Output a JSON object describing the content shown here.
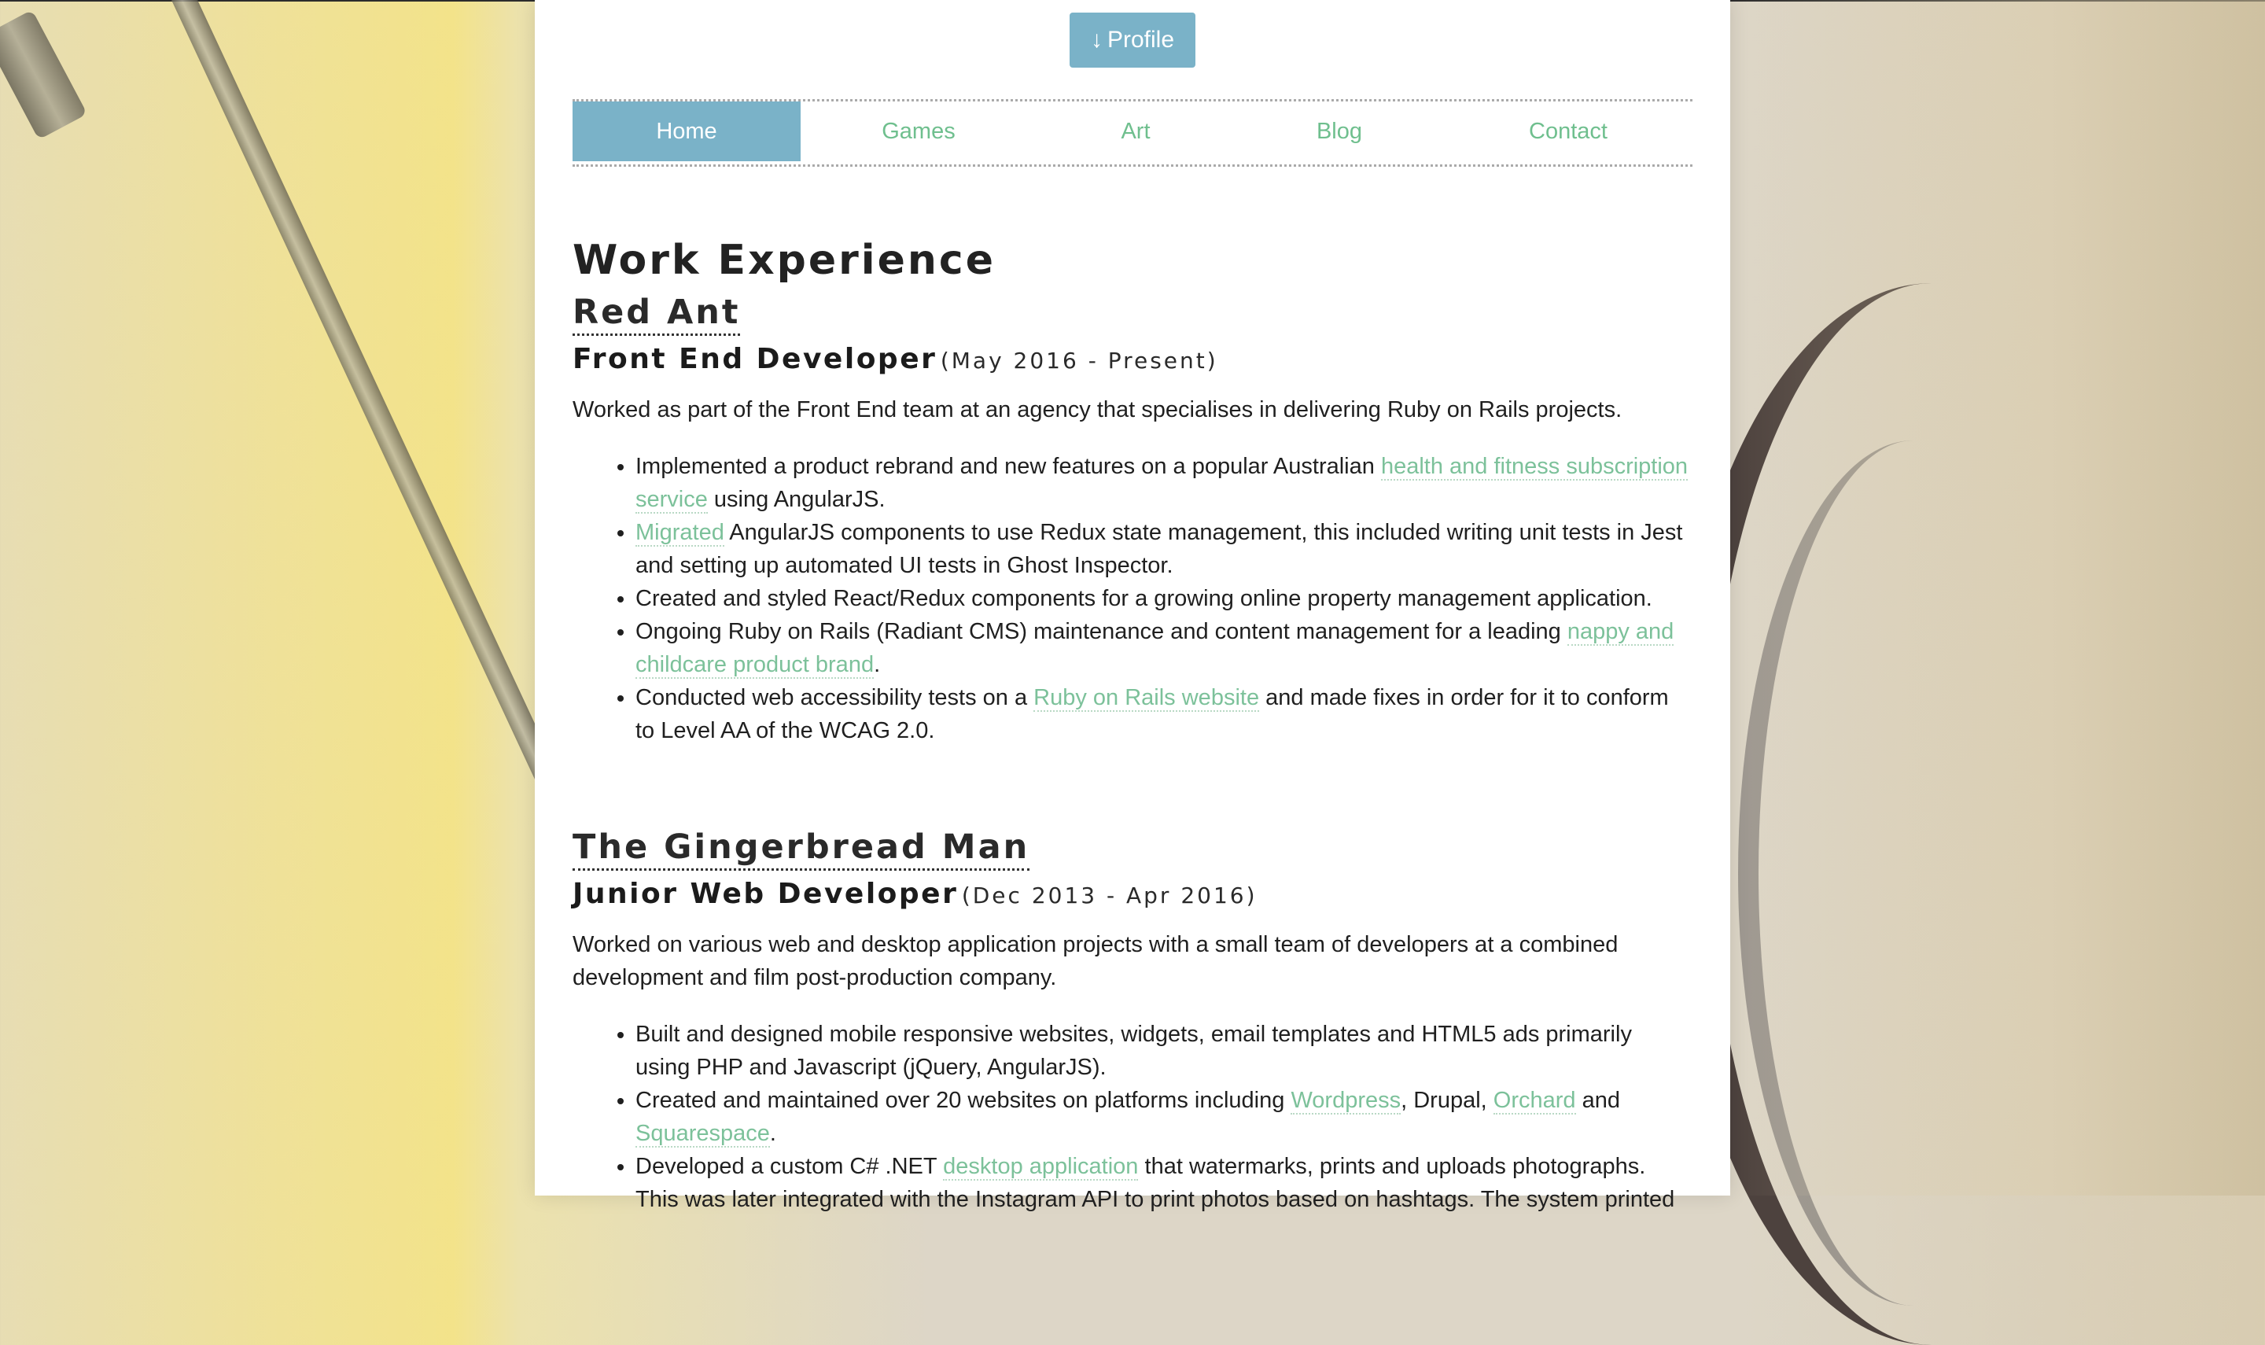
{
  "header": {
    "profile_button": {
      "icon": "arrow-down-icon",
      "arrow": "↓",
      "label": "Profile"
    }
  },
  "nav": {
    "items": [
      {
        "label": "Home",
        "active": true
      },
      {
        "label": "Games",
        "active": false
      },
      {
        "label": "Art",
        "active": false
      },
      {
        "label": "Blog",
        "active": false
      },
      {
        "label": "Contact",
        "active": false
      }
    ]
  },
  "main": {
    "title": "Work Experience",
    "jobs": [
      {
        "company": "Red Ant",
        "role": "Front End Developer",
        "dates": "(May 2016 - Present)",
        "description": "Worked as part of the Front End team at an agency that specialises in delivering Ruby on Rails projects.",
        "bullets": [
          {
            "pre": "Implemented a product rebrand and new features on a popular Australian ",
            "link": "health and fitness subscription service",
            "post": " using AngularJS."
          },
          {
            "pre": "",
            "link": "Migrated",
            "post": " AngularJS components to use Redux state management, this included writing unit tests in Jest and setting up automated UI tests in Ghost Inspector."
          },
          {
            "text": "Created and styled React/Redux components for a growing online property management application."
          },
          {
            "pre": "Ongoing Ruby on Rails (Radiant CMS) maintenance and content management for a leading ",
            "link": "nappy and childcare product brand",
            "post": "."
          },
          {
            "pre": "Conducted web accessibility tests on a ",
            "link": "Ruby on Rails website",
            "post": " and made fixes in order for it to conform to Level AA of the WCAG 2.0."
          }
        ]
      },
      {
        "company": "The Gingerbread Man",
        "role": "Junior Web Developer",
        "dates": "(Dec 2013 - Apr 2016)",
        "description": "Worked on various web and desktop application projects with a small team of developers at a combined development and film post-production company.",
        "bullets": [
          {
            "text": "Built and designed mobile responsive websites, widgets, email templates and HTML5 ads primarily using PHP and Javascript (jQuery, AngularJS)."
          },
          {
            "pre": "Created and maintained over 20 websites on platforms including ",
            "link1": "Wordpress",
            "mid1": ", Drupal, ",
            "link2": "Orchard",
            "mid2": " and ",
            "link3": "Squarespace",
            "post": "."
          },
          {
            "pre": "Developed a custom C# .NET ",
            "link": "desktop application",
            "post": " that watermarks, prints and uploads photographs. This was later integrated with the Instagram API to print photos based on hashtags. The system printed"
          }
        ]
      }
    ]
  },
  "colors": {
    "accent": "#7ab2c8",
    "link": "#7cc19a",
    "text": "#1f1f1f"
  }
}
